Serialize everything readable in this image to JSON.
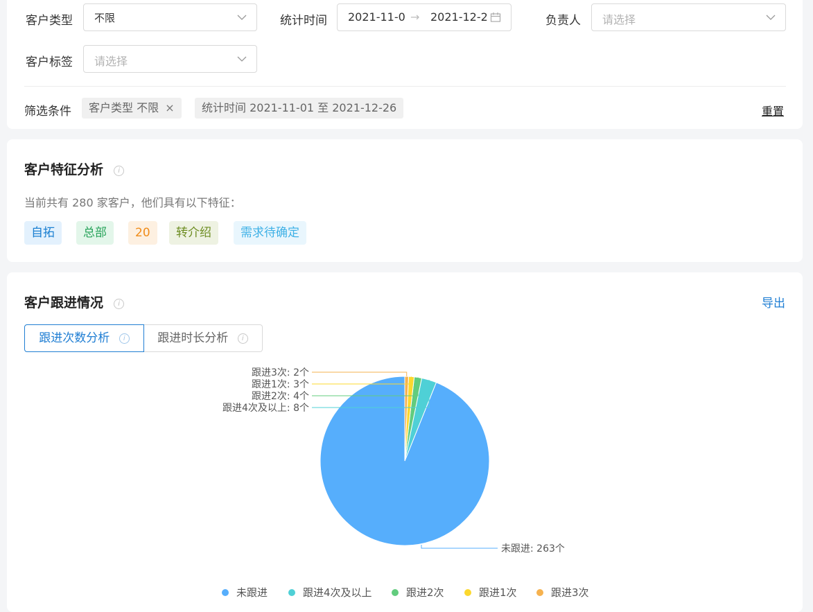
{
  "filters": {
    "customer_type": {
      "label": "客户类型",
      "value": "不限"
    },
    "stat_time": {
      "label": "统计时间",
      "start": "2021-11-0",
      "separator": "→",
      "end": "2021-12-2"
    },
    "owner": {
      "label": "负责人",
      "placeholder": "请选择"
    },
    "customer_tag": {
      "label": "客户标签",
      "placeholder": "请选择"
    },
    "conditions_label": "筛选条件",
    "condition_tags": [
      {
        "text": "客户类型 不限",
        "closable": true
      },
      {
        "text": "统计时间 2021-11-01 至 2021-12-26",
        "closable": false
      }
    ],
    "close_glyph": "×",
    "reset_label": "重置"
  },
  "features": {
    "title": "客户特征分析",
    "info_glyph": "i",
    "summary": "当前共有 280 家客户，他们具有以下特征：",
    "tags": [
      {
        "text": "自拓",
        "color": "#1a7fd1",
        "bg": "#e3f1fd"
      },
      {
        "text": "总部",
        "color": "#27a35a",
        "bg": "#e3f6ea"
      },
      {
        "text": "20",
        "color": "#f08c1a",
        "bg": "#fdf0e1"
      },
      {
        "text": "转介绍",
        "color": "#6d8d22",
        "bg": "#eef2e2"
      },
      {
        "text": "需求待确定",
        "color": "#3fb1e6",
        "bg": "#e9f6fd"
      }
    ]
  },
  "followup": {
    "title": "客户跟进情况",
    "info_glyph": "i",
    "export_label": "导出",
    "tabs": [
      {
        "label": "跟进次数分析",
        "active": true
      },
      {
        "label": "跟进时长分析",
        "active": false
      }
    ]
  },
  "colors": {
    "accent": "#1f7ed3",
    "border": "#d9d9d9"
  },
  "chart_data": {
    "type": "pie",
    "title": "",
    "unit": "个",
    "slices": [
      {
        "name": "未跟进",
        "value": 263,
        "color": "#56aefc",
        "label": "未跟进: 263个"
      },
      {
        "name": "跟进4次及以上",
        "value": 8,
        "color": "#4fd0d6",
        "label": "跟进4次及以上: 8个"
      },
      {
        "name": "跟进2次",
        "value": 4,
        "color": "#62cc7e",
        "label": "跟进2次: 4个"
      },
      {
        "name": "跟进1次",
        "value": 3,
        "color": "#fcd82e",
        "label": "跟进1次: 3个"
      },
      {
        "name": "跟进3次",
        "value": 2,
        "color": "#f6b24f",
        "label": "跟进3次: 2个"
      }
    ],
    "legend": {
      "position": "bottom",
      "items": [
        "未跟进",
        "跟进4次及以上",
        "跟进2次",
        "跟进1次",
        "跟进3次"
      ]
    }
  }
}
